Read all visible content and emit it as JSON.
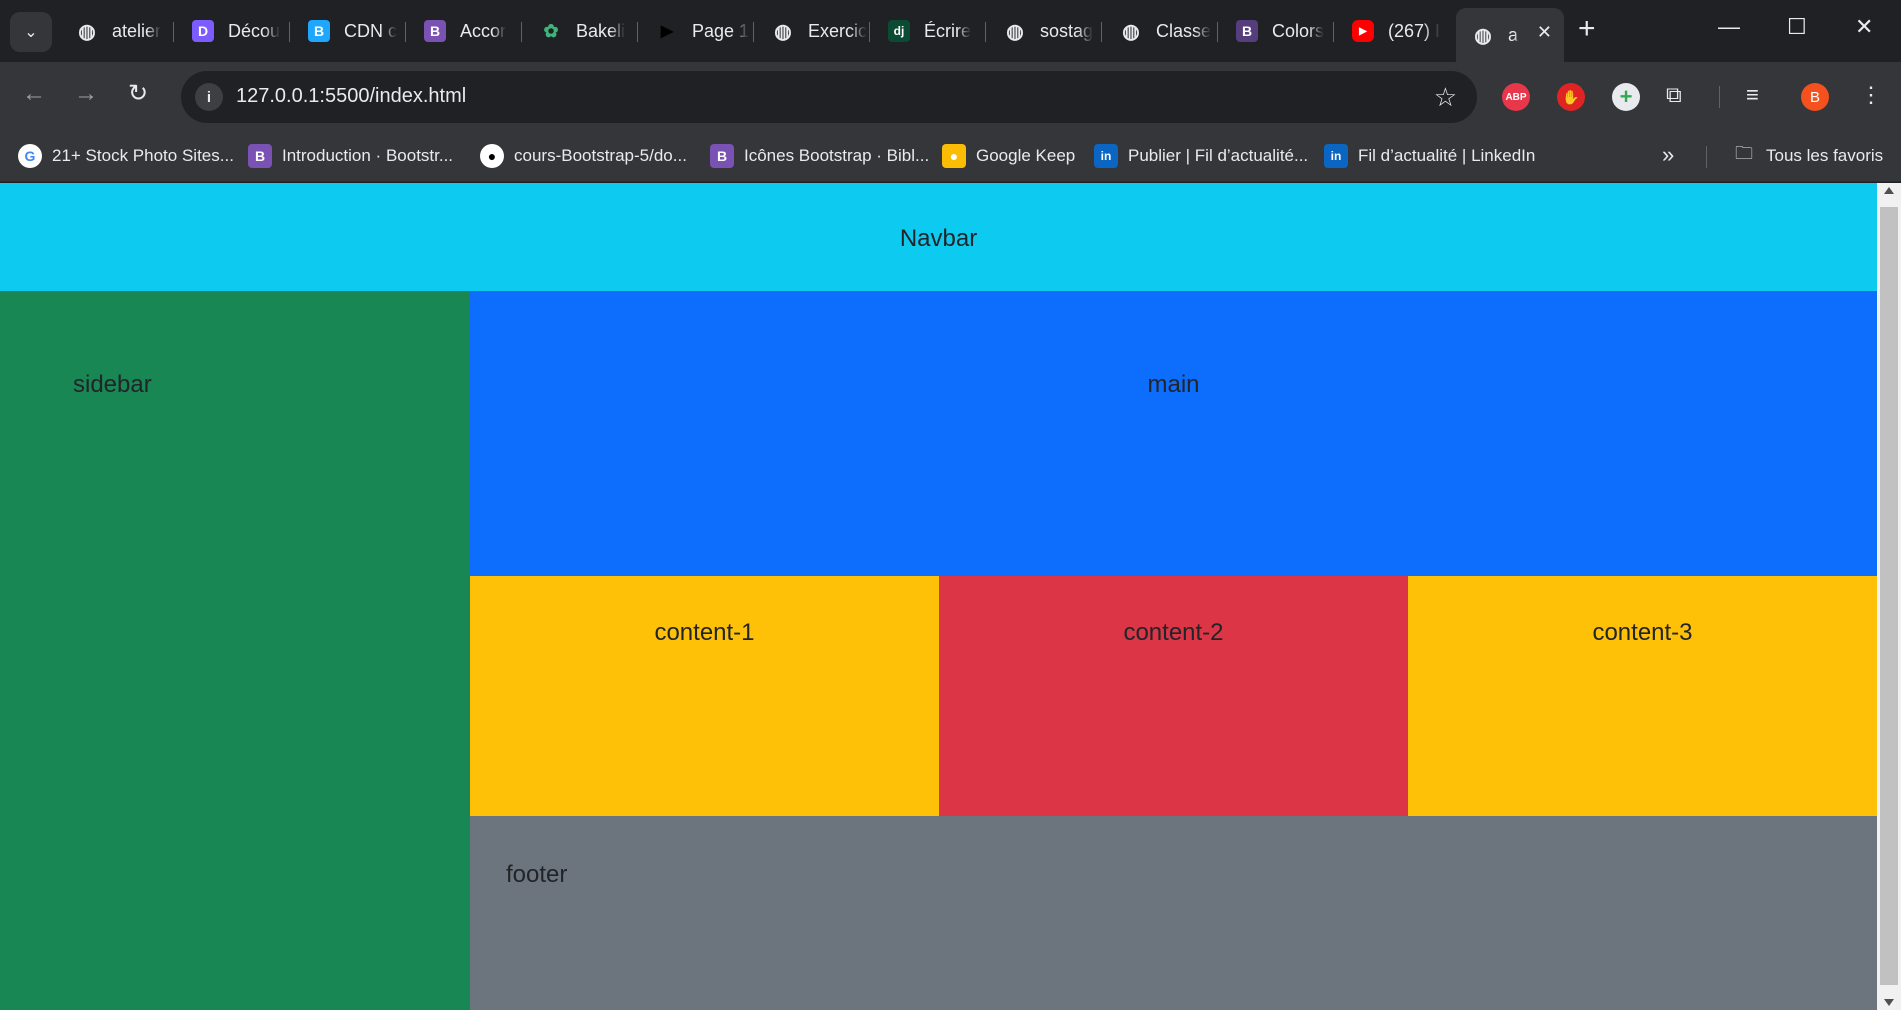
{
  "browser": {
    "tabs": [
      {
        "title": "atelier",
        "icon": "globe-icon",
        "color": "#5f6368"
      },
      {
        "title": "Décou",
        "icon": "D",
        "color": "#7c5cff"
      },
      {
        "title": "CDN c",
        "icon": "B",
        "color": "#1ea7fd"
      },
      {
        "title": "Accor",
        "icon": "B",
        "color": "#7952b3"
      },
      {
        "title": "Bakeli",
        "icon": "bakeli-logo-icon",
        "color": "#1a7f5a"
      },
      {
        "title": "Page 1",
        "icon": "play-icon",
        "color": "#000000"
      },
      {
        "title": "Exercic",
        "icon": "globe-icon",
        "color": "#5f6368"
      },
      {
        "title": "Écrire",
        "icon": "dj",
        "color": "#0c4b33"
      },
      {
        "title": "sostag",
        "icon": "globe-icon",
        "color": "#5f6368"
      },
      {
        "title": "Classe",
        "icon": "globe-icon",
        "color": "#5f6368"
      },
      {
        "title": "Colors",
        "icon": "B",
        "color": "#563d7c"
      },
      {
        "title": "(267) I",
        "icon": "youtube-icon",
        "color": "#ff0000"
      },
      {
        "title": "a",
        "icon": "globe-icon",
        "color": "#5f6368",
        "active": true
      }
    ],
    "url": "127.0.0.1:5500/index.html",
    "extensions": [
      {
        "name": "adblock-plus-icon",
        "label": "ABP",
        "color": "#e8364b"
      },
      {
        "name": "stop-hand-icon",
        "label": "✋",
        "color": "#e02424"
      },
      {
        "name": "plus-circle-icon",
        "label": "+",
        "color": "#34a853"
      }
    ],
    "profile_initial": "B",
    "profile_color": "#f4511e",
    "bookmarks": [
      {
        "label": "21+ Stock Photo Sites...",
        "icon": "G",
        "color": "#ffffff"
      },
      {
        "label": "Introduction · Bootstr...",
        "icon": "B",
        "color": "#7952b3"
      },
      {
        "label": "cours-Bootstrap-5/do...",
        "icon": "github-icon",
        "color": "#ffffff"
      },
      {
        "label": "Icônes Bootstrap · Bibl...",
        "icon": "B",
        "color": "#7952b3"
      },
      {
        "label": "Google Keep",
        "icon": "keep-icon",
        "color": "#fbbc04"
      },
      {
        "label": "Publier | Fil d’actualité...",
        "icon": "in",
        "color": "#0a66c2"
      },
      {
        "label": "Fil d’actualité | LinkedIn",
        "icon": "in",
        "color": "#0a66c2"
      }
    ],
    "all_bookmarks_label": "Tous les favoris"
  },
  "page": {
    "navbar": "Navbar",
    "sidebar": "sidebar",
    "main": "main",
    "content_1": "content-1",
    "content_2": "content-2",
    "content_3": "content-3",
    "footer": "footer",
    "colors": {
      "navbar": "#0dcaf0",
      "sidebar": "#198754",
      "main": "#0d6efd",
      "content_warning": "#ffc107",
      "content_danger": "#dc3545",
      "footer": "#6c757d"
    }
  }
}
